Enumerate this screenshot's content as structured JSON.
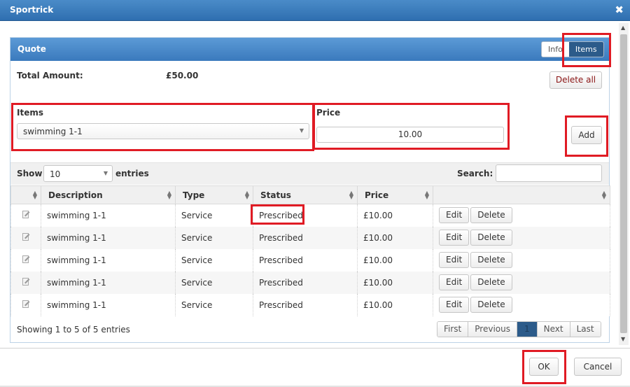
{
  "window": {
    "title": "Sportrick",
    "close_glyph": "✖"
  },
  "panel": {
    "title": "Quote",
    "tabs": [
      "Info",
      "Items"
    ],
    "active_tab": "Items"
  },
  "summary": {
    "total_label": "Total Amount:",
    "total_value": "£50.00",
    "delete_all_label": "Delete all"
  },
  "form": {
    "items_label": "Items",
    "items_value": "swimming 1-1",
    "price_label": "Price",
    "price_value": "10.00",
    "add_label": "Add"
  },
  "table": {
    "show_label": "Show",
    "page_length": "10",
    "entries_label": "entries",
    "search_label": "Search:",
    "search_value": "",
    "columns": [
      "",
      "Description",
      "Type",
      "Status",
      "Price",
      ""
    ],
    "rows": [
      {
        "description": "swimming 1-1",
        "type": "Service",
        "status": "Prescribed",
        "price": "£10.00"
      },
      {
        "description": "swimming 1-1",
        "type": "Service",
        "status": "Prescribed",
        "price": "£10.00"
      },
      {
        "description": "swimming 1-1",
        "type": "Service",
        "status": "Prescribed",
        "price": "£10.00"
      },
      {
        "description": "swimming 1-1",
        "type": "Service",
        "status": "Prescribed",
        "price": "£10.00"
      },
      {
        "description": "swimming 1-1",
        "type": "Service",
        "status": "Prescribed",
        "price": "£10.00"
      }
    ],
    "edit_label": "Edit",
    "delete_label": "Delete",
    "info": "Showing 1 to 5 of 5 entries",
    "pager": {
      "first": "First",
      "previous": "Previous",
      "current": "1",
      "next": "Next",
      "last": "Last"
    }
  },
  "dialog_buttons": {
    "ok": "OK",
    "cancel": "Cancel"
  },
  "colors": {
    "header_blue": "#3a7abd",
    "highlight_red": "#e01b24",
    "active_tab": "#2c5b8a"
  }
}
